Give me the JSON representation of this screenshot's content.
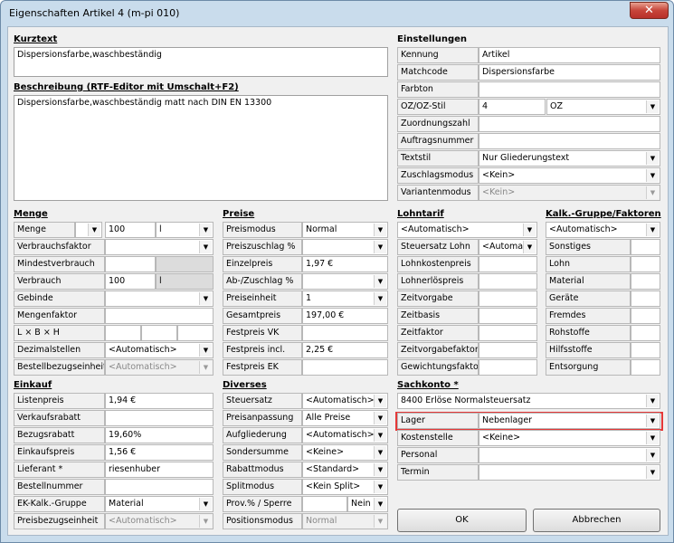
{
  "window": {
    "title": "Eigenschaften Artikel 4 (m-pi 010)",
    "close": "✕"
  },
  "kurztext": {
    "title": "Kurztext",
    "value": "Dispersionsfarbe,waschbeständig"
  },
  "beschreibung": {
    "title": "Beschreibung (RTF-Editor mit Umschalt+F2)",
    "value": "Dispersionsfarbe,waschbeständig matt nach DIN EN 13300"
  },
  "einstellungen": {
    "title": "Einstellungen",
    "rows": [
      {
        "label": "Kennung",
        "value": "Artikel"
      },
      {
        "label": "Matchcode",
        "value": "Dispersionsfarbe"
      },
      {
        "label": "Farbton",
        "value": ""
      },
      {
        "label": "OZ/OZ-Stil",
        "value": "4",
        "value2": "OZ"
      },
      {
        "label": "Zuordnungszahl",
        "value": ""
      },
      {
        "label": "Auftragsnummer",
        "value": ""
      },
      {
        "label": "Textstil",
        "value": "Nur Gliederungstext"
      },
      {
        "label": "Zuschlagsmodus",
        "value": "<Kein>"
      },
      {
        "label": "Variantenmodus",
        "value": "<Kein>"
      }
    ]
  },
  "menge": {
    "title": "Menge",
    "rows": [
      {
        "label": "Menge",
        "value": "100",
        "unit": "l"
      },
      {
        "label": "Verbrauchsfaktor",
        "value": ""
      },
      {
        "label": "Mindestverbrauch",
        "value": ""
      },
      {
        "label": "Verbrauch",
        "value": "100",
        "unit": "l"
      },
      {
        "label": "Gebinde",
        "value": ""
      },
      {
        "label": "Mengenfaktor",
        "value": ""
      },
      {
        "label": "L × B × H",
        "value": ""
      },
      {
        "label": "Dezimalstellen",
        "value": "<Automatisch>"
      },
      {
        "label": "Bestellbezugseinheit",
        "value": "<Automatisch>"
      }
    ]
  },
  "preise": {
    "title": "Preise",
    "rows": [
      {
        "label": "Preismodus",
        "value": "Normal"
      },
      {
        "label": "Preiszuschlag %",
        "value": ""
      },
      {
        "label": "Einzelpreis",
        "value": "1,97 €"
      },
      {
        "label": "Ab-/Zuschlag %",
        "value": ""
      },
      {
        "label": "Preiseinheit",
        "value": "1"
      },
      {
        "label": "Gesamtpreis",
        "value": "197,00 €"
      },
      {
        "label": "Festpreis VK",
        "value": ""
      },
      {
        "label": "Festpreis incl.",
        "value": "2,25 €"
      },
      {
        "label": "Festpreis EK",
        "value": ""
      }
    ]
  },
  "lohntarif": {
    "title": "Lohntarif",
    "top": "<Automatisch>",
    "rows": [
      {
        "label": "Steuersatz Lohn",
        "value": "<Automat"
      },
      {
        "label": "Lohnkostenpreis",
        "value": ""
      },
      {
        "label": "Lohnerlöspreis",
        "value": ""
      },
      {
        "label": "Zeitvorgabe",
        "value": ""
      },
      {
        "label": "Zeitbasis",
        "value": ""
      },
      {
        "label": "Zeitfaktor",
        "value": ""
      },
      {
        "label": "Zeitvorgabefaktor",
        "value": ""
      },
      {
        "label": "Gewichtungsfaktor",
        "value": ""
      }
    ]
  },
  "kalk": {
    "title": "Kalk.-Gruppe/Faktoren",
    "top": "<Automatisch>",
    "rows": [
      {
        "label": "Sonstiges"
      },
      {
        "label": "Lohn"
      },
      {
        "label": "Material"
      },
      {
        "label": "Geräte"
      },
      {
        "label": "Fremdes"
      },
      {
        "label": "Rohstoffe"
      },
      {
        "label": "Hilfsstoffe"
      },
      {
        "label": "Entsorgung"
      }
    ]
  },
  "einkauf": {
    "title": "Einkauf",
    "rows": [
      {
        "label": "Listenpreis",
        "value": "1,94 €"
      },
      {
        "label": "Verkaufsrabatt",
        "value": ""
      },
      {
        "label": "Bezugsrabatt",
        "value": "19,60%"
      },
      {
        "label": "Einkaufspreis",
        "value": "1,56 €"
      },
      {
        "label": "Lieferant *",
        "value": "riesenhuber"
      },
      {
        "label": "Bestellnummer",
        "value": ""
      },
      {
        "label": "EK-Kalk.-Gruppe",
        "value": "Material"
      },
      {
        "label": "Preisbezugseinheit",
        "value": "<Automatisch>"
      }
    ]
  },
  "diverses": {
    "title": "Diverses",
    "rows": [
      {
        "label": "Steuersatz",
        "value": "<Automatisch>"
      },
      {
        "label": "Preisanpassung",
        "value": "Alle Preise"
      },
      {
        "label": "Aufgliederung",
        "value": "<Automatisch>"
      },
      {
        "label": "Sondersumme",
        "value": "<Keine>"
      },
      {
        "label": "Rabattmodus",
        "value": "<Standard>"
      },
      {
        "label": "Splitmodus",
        "value": "<Kein Split>"
      },
      {
        "label": "Prov.% / Sperre",
        "value": "",
        "value2": "Nein"
      },
      {
        "label": "Positionsmodus",
        "value": "Normal"
      }
    ]
  },
  "sachkonto": {
    "title": "Sachkonto *",
    "top": "8400 Erlöse Normalsteuersatz",
    "rows": [
      {
        "label": "Lager",
        "value": "Nebenlager"
      },
      {
        "label": "Kostenstelle",
        "value": "<Keine>"
      },
      {
        "label": "Personal",
        "value": ""
      },
      {
        "label": "Termin",
        "value": ""
      }
    ]
  },
  "buttons": {
    "ok": "OK",
    "cancel": "Abbrechen"
  },
  "colors": {
    "highlight": "#e53838",
    "field": "#ffffff",
    "label_bg": "#f0f0f0",
    "frame": "#c9dcec"
  },
  "icons": {
    "dropdown": "▼"
  }
}
